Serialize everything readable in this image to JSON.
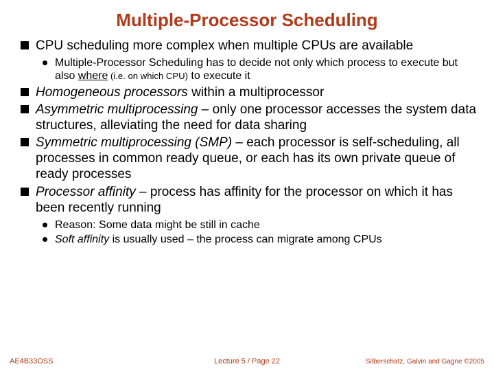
{
  "title": "Multiple-Processor Scheduling",
  "bullets": {
    "b1": {
      "text": "CPU scheduling more complex when multiple CPUs are available",
      "sub1_a": "Multiple-Processor Scheduling has to decide not only which process to execute but also ",
      "sub1_where": "where",
      "sub1_b": " (i.e. on which CPU)",
      "sub1_c": " to execute it"
    },
    "b2": {
      "term": "Homogeneous processors",
      "rest": " within a multiprocessor"
    },
    "b3": {
      "term": "Asymmetric multiprocessing",
      "rest": " – only one processor accesses the system data structures, alleviating the need for data sharing"
    },
    "b4": {
      "term": "Symmetric multiprocessing  (SMP)",
      "rest": " – each processor is self-scheduling, all processes in common ready queue, or each has its own private queue of ready processes"
    },
    "b5": {
      "term": "Processor affinity",
      "rest": " – process has affinity for the processor on which it has been recently running",
      "sub1": "Reason: Some data might be still in cache",
      "sub2_term": "Soft affinity",
      "sub2_rest": " is usually used – the process can migrate among CPUs"
    }
  },
  "footer": {
    "left": "AE4B33OSS",
    "center": "Lecture 5 / Page 22",
    "right": "Silberschatz, Galvin and Gagne ©2005"
  }
}
